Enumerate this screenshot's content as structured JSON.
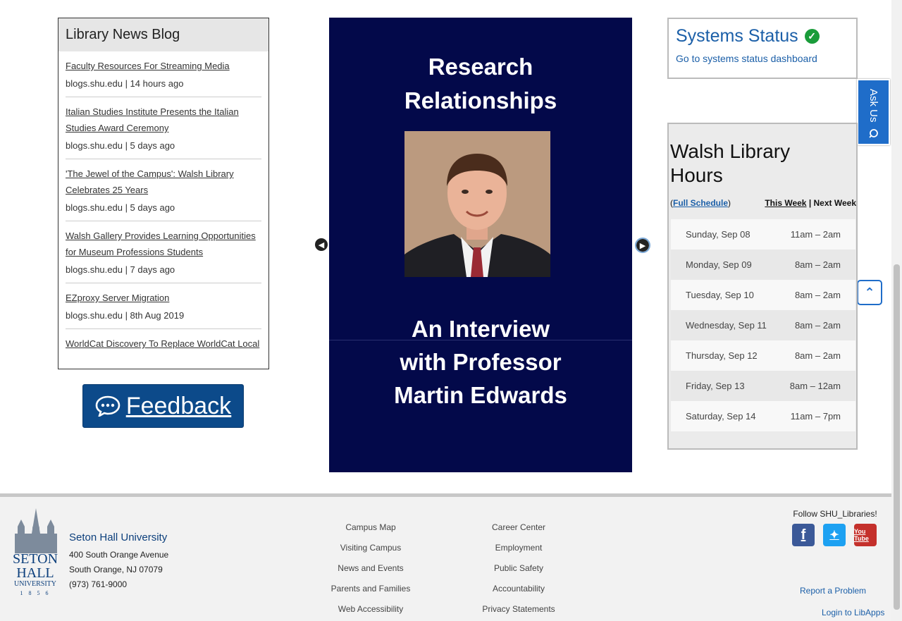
{
  "blog": {
    "title": "Library News Blog",
    "items": [
      {
        "title": "Faculty Resources For Streaming Media",
        "meta": "blogs.shu.edu | 14 hours ago"
      },
      {
        "title": "Italian Studies Institute Presents the Italian Studies Award Ceremony",
        "meta": "blogs.shu.edu | 5 days ago"
      },
      {
        "title": "'The Jewel of the Campus': Walsh Library Celebrates 25 Years",
        "meta": "blogs.shu.edu | 5 days ago"
      },
      {
        "title": "Walsh Gallery Provides Learning Opportunities for Museum Professions Students",
        "meta": "blogs.shu.edu | 7 days ago"
      },
      {
        "title": "EZproxy Server Migration",
        "meta": "blogs.shu.edu | 8th Aug 2019"
      },
      {
        "title": "WorldCat Discovery To Replace WorldCat Local",
        "meta": ""
      }
    ]
  },
  "feedback": {
    "label": "Feedback",
    "icon": "chat-bubble-icon"
  },
  "carousel": {
    "title_line1": "Research",
    "title_line2": "Relationships",
    "sub_line1": "An Interview",
    "sub_line2": "with Professor",
    "sub_line3": "Martin Edwards",
    "bg_color": "#03094a"
  },
  "status": {
    "title": "Systems Status",
    "link": "Go to systems status dashboard",
    "icon": "check-circle-icon"
  },
  "ask_us": {
    "label": "Ask Us"
  },
  "hours": {
    "title": "Walsh Library Hours",
    "full_schedule": "Full Schedule",
    "this_week": "This Week",
    "separator": "|",
    "next_week": "Next Week",
    "rows": [
      {
        "day": "Sunday, Sep 08",
        "time": "11am – 2am"
      },
      {
        "day": "Monday, Sep 09",
        "time": "8am – 2am"
      },
      {
        "day": "Tuesday, Sep 10",
        "time": "8am – 2am"
      },
      {
        "day": "Wednesday, Sep 11",
        "time": "8am – 2am"
      },
      {
        "day": "Thursday, Sep 12",
        "time": "8am – 2am"
      },
      {
        "day": "Friday, Sep 13",
        "time": "8am – 12am"
      },
      {
        "day": "Saturday, Sep 14",
        "time": "11am – 7pm"
      }
    ]
  },
  "footer": {
    "logo": {
      "line1": "SETON",
      "line2": "HALL",
      "line3": "UNIVERSITY",
      "year": "1 8 5 6"
    },
    "university": "Seton Hall University",
    "address1": "400 South Orange Avenue",
    "address2": "South Orange, NJ 07079",
    "phone": "(973) 761-9000",
    "col1": [
      "Campus Map",
      "Visiting Campus",
      "News and Events",
      "Parents and Families",
      "Web Accessibility"
    ],
    "col2": [
      "Career Center",
      "Employment",
      "Public Safety",
      "Accountability",
      "Privacy Statements"
    ],
    "follow": "Follow SHU_Libraries!",
    "youtube_label": "You Tube",
    "report": "Report a Problem",
    "login": "Login to LibApps"
  }
}
